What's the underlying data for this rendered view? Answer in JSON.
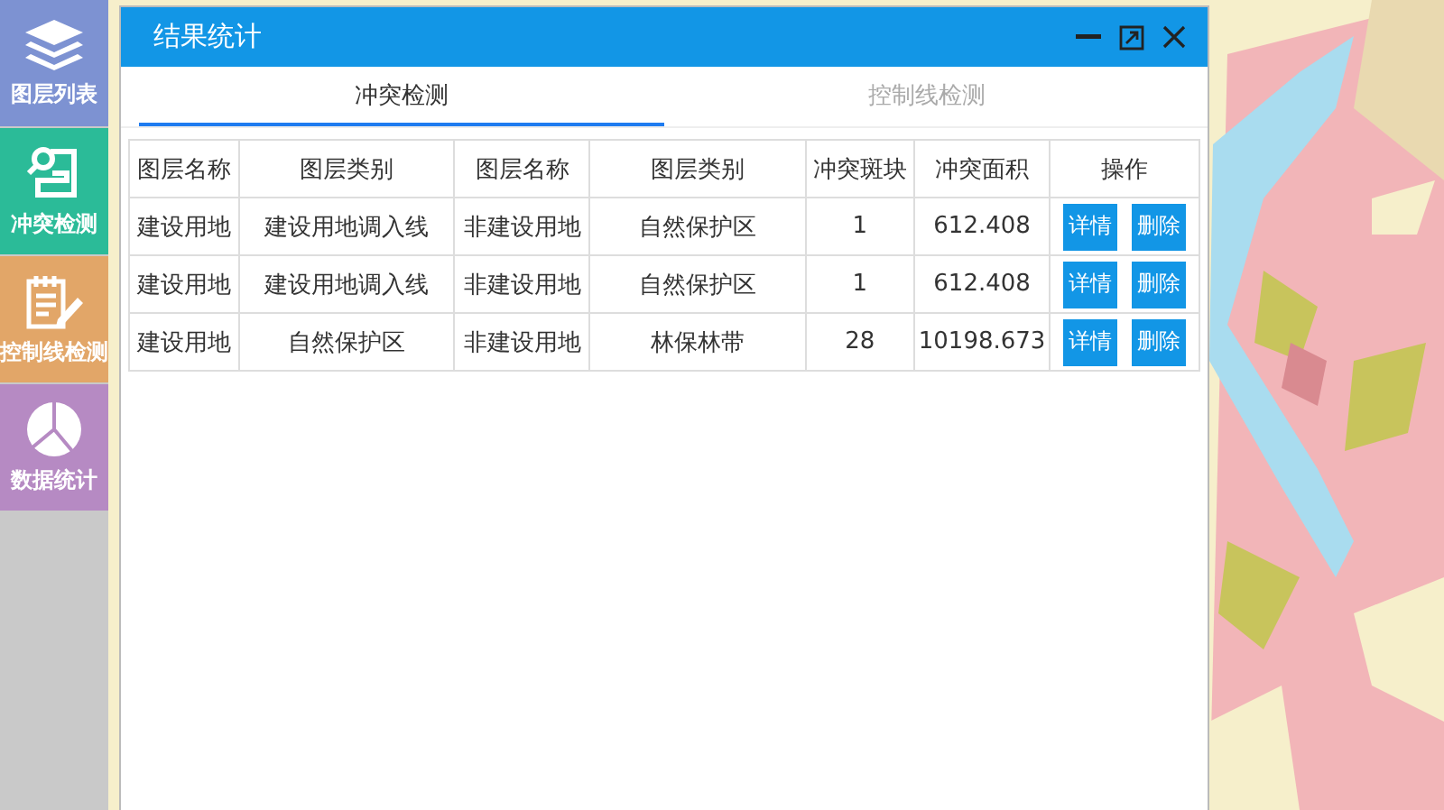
{
  "sidebar": {
    "items": [
      {
        "label": "图层列表",
        "color": "#7d92d2"
      },
      {
        "label": "冲突检测",
        "color": "#2bbb98"
      },
      {
        "label": "控制线检测",
        "color": "#e2a668"
      },
      {
        "label": "数据统计",
        "color": "#b68ac3"
      }
    ]
  },
  "window": {
    "title": "结果统计"
  },
  "tabs": [
    {
      "label": "冲突检测",
      "selected": true
    },
    {
      "label": "控制线检测",
      "selected": false
    }
  ],
  "table": {
    "columns": [
      "图层名称",
      "图层类别",
      "图层名称",
      "图层类别",
      "冲突斑块",
      "冲突面积",
      "操作"
    ],
    "rows": [
      {
        "cells": [
          "建设用地",
          "建设用地调入线",
          "非建设用地",
          "自然保护区",
          "1",
          "612.408"
        ],
        "actions": [
          "详情",
          "删除"
        ]
      },
      {
        "cells": [
          "建设用地",
          "建设用地调入线",
          "非建设用地",
          "自然保护区",
          "1",
          "612.408"
        ],
        "actions": [
          "详情",
          "删除"
        ]
      },
      {
        "cells": [
          "建设用地",
          "自然保护区",
          "非建设用地",
          "林保林带",
          "28",
          "10198.673"
        ],
        "actions": [
          "详情",
          "删除"
        ]
      }
    ]
  }
}
